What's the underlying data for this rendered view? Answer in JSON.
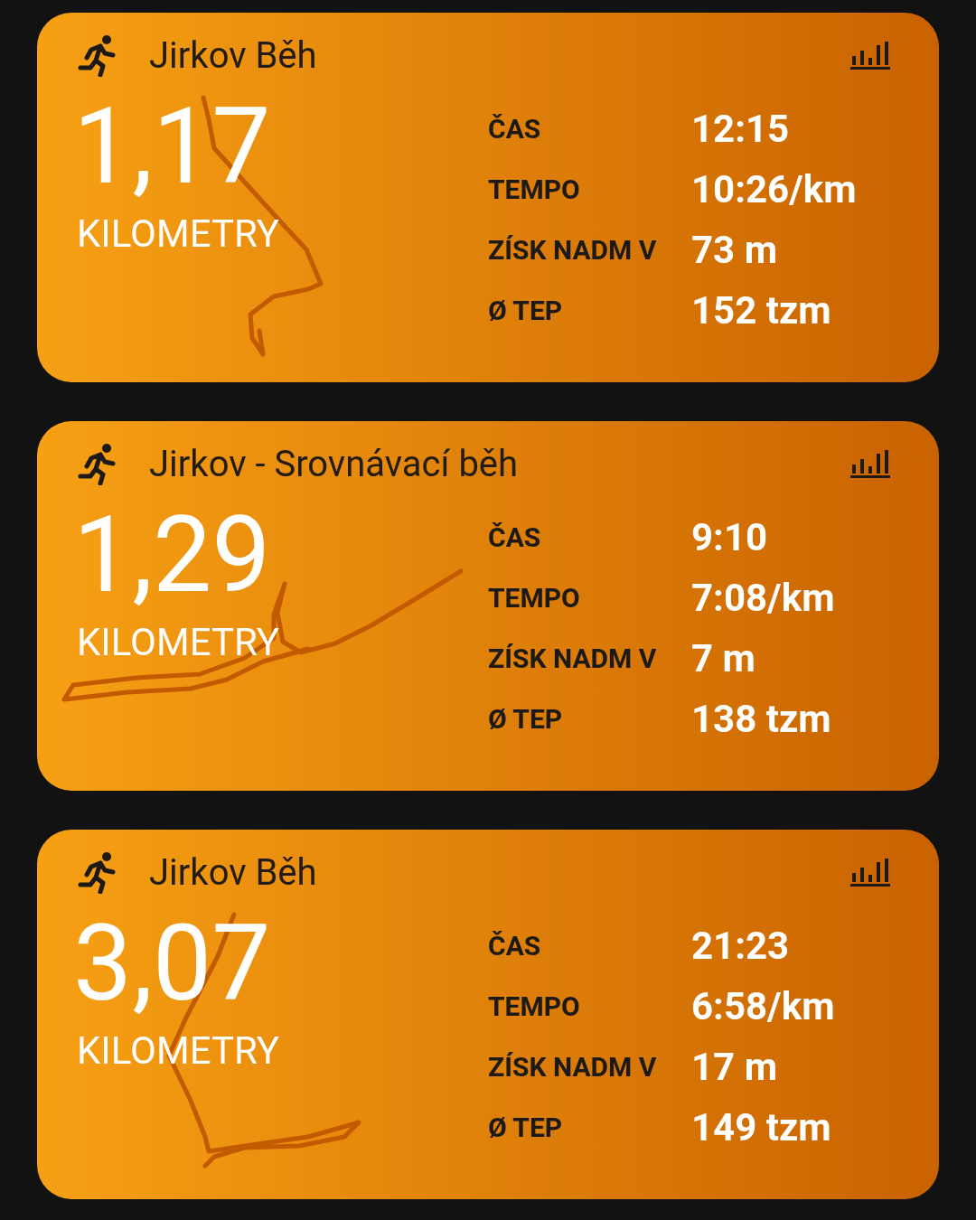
{
  "activities": [
    {
      "title": "Jirkov Běh",
      "distance": "1,17",
      "unit": "KILOMETRY",
      "stats": [
        {
          "label": "ČAS",
          "value": "12:15"
        },
        {
          "label": "TEMPO",
          "value": "10:26/km"
        },
        {
          "label": "ZÍSK NADM V",
          "value": "73 m"
        },
        {
          "label": "Ø TEP",
          "value": "152 tzm"
        }
      ]
    },
    {
      "title": "Jirkov - Srovnávací běh",
      "distance": "1,29",
      "unit": "KILOMETRY",
      "stats": [
        {
          "label": "ČAS",
          "value": "9:10"
        },
        {
          "label": "TEMPO",
          "value": "7:08/km"
        },
        {
          "label": "ZÍSK NADM V",
          "value": "7 m"
        },
        {
          "label": "Ø TEP",
          "value": "138 tzm"
        }
      ]
    },
    {
      "title": "Jirkov Běh",
      "distance": "3,07",
      "unit": "KILOMETRY",
      "stats": [
        {
          "label": "ČAS",
          "value": "21:23"
        },
        {
          "label": "TEMPO",
          "value": "6:58/km"
        },
        {
          "label": "ZÍSK NADM V",
          "value": "17 m"
        },
        {
          "label": "Ø TEP",
          "value": "149 tzm"
        }
      ]
    }
  ]
}
